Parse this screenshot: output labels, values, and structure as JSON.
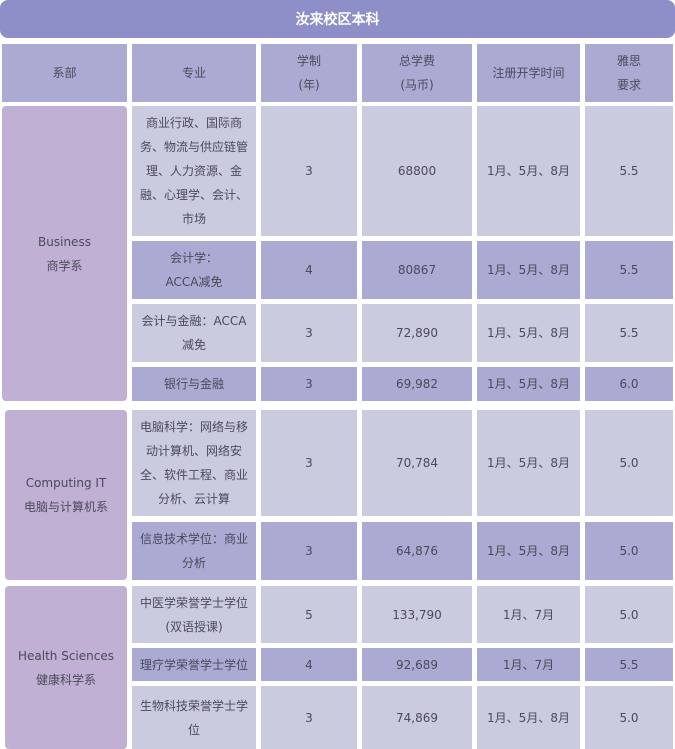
{
  "title": "汝来校区本科",
  "headers": {
    "department": "系部",
    "major": "专业",
    "duration": [
      "学制",
      "(年)"
    ],
    "fee": [
      "总学费",
      "(马币)"
    ],
    "intake": "注册开学时间",
    "ielts": [
      "雅思",
      "要求"
    ]
  },
  "departments": [
    {
      "name_en": "Business",
      "name_cn": "商学系"
    },
    {
      "name_en": "Computing IT",
      "name_cn": "电脑与计算机系"
    },
    {
      "name_en": "Health Sciences",
      "name_cn": "健康科学系"
    }
  ],
  "rows": [
    {
      "major": [
        "商业行政、国际商",
        "务、物流与供应链管",
        "理、人力资源、金",
        "融、心理学、会计、",
        "市场"
      ],
      "duration": "3",
      "fee": "68800",
      "intake": "1月、5月、8月",
      "ielts": "5.5"
    },
    {
      "major": [
        "会计学：",
        "ACCA减免"
      ],
      "duration": "4",
      "fee": "80867",
      "intake": "1月、5月、8月",
      "ielts": "5.5"
    },
    {
      "major": [
        "会计与金融：ACCA",
        "减免"
      ],
      "duration": "3",
      "fee": "72,890",
      "intake": "1月、5月、8月",
      "ielts": "5.5"
    },
    {
      "major": [
        "银行与金融"
      ],
      "duration": "3",
      "fee": "69,982",
      "intake": "1月、5月、8月",
      "ielts": "6.0"
    },
    {
      "major": [
        "电脑科学：网络与移",
        "动计算机、网络安",
        "全、软件工程、商业",
        "分析、云计算"
      ],
      "duration": "3",
      "fee": "70,784",
      "intake": "1月、5月、8月",
      "ielts": "5.0"
    },
    {
      "major": [
        "信息技术学位：商业",
        "分析"
      ],
      "duration": "3",
      "fee": "64,876",
      "intake": "1月、5月、8月",
      "ielts": "5.0"
    },
    {
      "major": [
        "中医学荣誉学士学位",
        "(双语授课)"
      ],
      "duration": "5",
      "fee": "133,790",
      "intake": "1月、7月",
      "ielts": "5.0"
    },
    {
      "major": [
        "理疗学荣誉学士学位"
      ],
      "duration": "4",
      "fee": "92,689",
      "intake": "1月、7月",
      "ielts": "5.5"
    },
    {
      "major": [
        "生物科技荣誉学士学",
        "位"
      ],
      "duration": "3",
      "fee": "74,869",
      "intake": "1月、5月、8月",
      "ielts": "5.0"
    }
  ]
}
